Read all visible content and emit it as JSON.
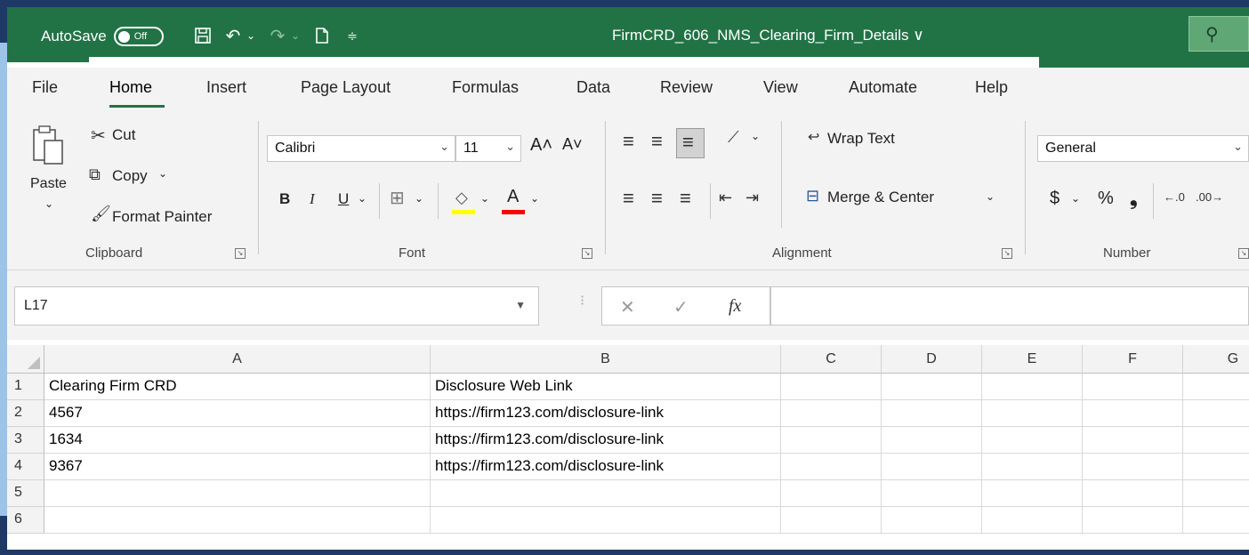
{
  "titlebar": {
    "autosave_label": "AutoSave",
    "toggle_state": "Off",
    "document_title": "FirmCRD_606_NMS_Clearing_Firm_Details",
    "title_chevron": "∨",
    "search_icon": "⚲"
  },
  "tabs": [
    "File",
    "Home",
    "Insert",
    "Page Layout",
    "Formulas",
    "Data",
    "Review",
    "View",
    "Automate",
    "Help"
  ],
  "active_tab": "Home",
  "ribbon": {
    "clipboard": {
      "paste": "Paste",
      "cut": "Cut",
      "copy": "Copy",
      "format_painter": "Format Painter",
      "label": "Clipboard"
    },
    "font": {
      "font_name": "Calibri",
      "font_size": "11",
      "bold": "B",
      "italic": "I",
      "underline": "U",
      "label": "Font",
      "increase": "A˄",
      "decrease": "A˅",
      "font_color_glyph": "A"
    },
    "alignment": {
      "wrap_text": "Wrap Text",
      "merge_center": "Merge & Center",
      "label": "Alignment"
    },
    "number": {
      "format": "General",
      "currency": "$",
      "percent": "%",
      "comma": "❟",
      "label": "Number"
    }
  },
  "formula_bar": {
    "cell_ref": "L17",
    "cancel": "✕",
    "enter": "✓",
    "fx": "fx",
    "formula": ""
  },
  "grid": {
    "columns": [
      "A",
      "B",
      "C",
      "D",
      "E",
      "F",
      "G"
    ],
    "rows": [
      {
        "num": "1",
        "a": "Clearing Firm CRD",
        "b": "Disclosure Web Link"
      },
      {
        "num": "2",
        "a": "4567",
        "b": "https://firm123.com/disclosure-link"
      },
      {
        "num": "3",
        "a": "1634",
        "b": "https://firm123.com/disclosure-link"
      },
      {
        "num": "4",
        "a": "9367",
        "b": "https://firm123.com/disclosure-link"
      },
      {
        "num": "5",
        "a": "",
        "b": ""
      },
      {
        "num": "6",
        "a": "",
        "b": ""
      }
    ]
  },
  "colors": {
    "excel_green": "#217346",
    "background_navy": "#1f3864",
    "accent_light_blue": "#9dc3e6",
    "highlight_yellow": "#ffff00",
    "font_red": "#ff0000"
  }
}
